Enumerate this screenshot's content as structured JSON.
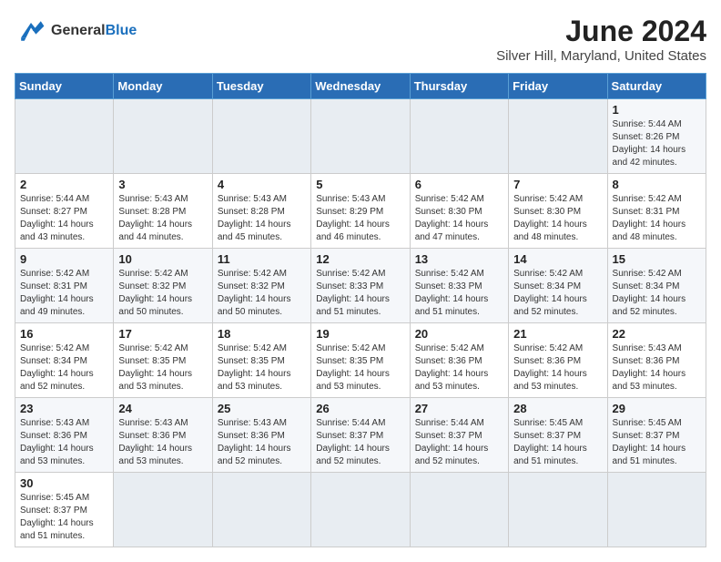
{
  "header": {
    "logo_general": "General",
    "logo_blue": "Blue",
    "title": "June 2024",
    "subtitle": "Silver Hill, Maryland, United States"
  },
  "weekdays": [
    "Sunday",
    "Monday",
    "Tuesday",
    "Wednesday",
    "Thursday",
    "Friday",
    "Saturday"
  ],
  "weeks": [
    [
      {
        "day": "",
        "info": ""
      },
      {
        "day": "",
        "info": ""
      },
      {
        "day": "",
        "info": ""
      },
      {
        "day": "",
        "info": ""
      },
      {
        "day": "",
        "info": ""
      },
      {
        "day": "",
        "info": ""
      },
      {
        "day": "1",
        "info": "Sunrise: 5:44 AM\nSunset: 8:26 PM\nDaylight: 14 hours and 42 minutes."
      }
    ],
    [
      {
        "day": "2",
        "info": "Sunrise: 5:44 AM\nSunset: 8:27 PM\nDaylight: 14 hours and 43 minutes."
      },
      {
        "day": "3",
        "info": "Sunrise: 5:43 AM\nSunset: 8:28 PM\nDaylight: 14 hours and 44 minutes."
      },
      {
        "day": "4",
        "info": "Sunrise: 5:43 AM\nSunset: 8:28 PM\nDaylight: 14 hours and 45 minutes."
      },
      {
        "day": "5",
        "info": "Sunrise: 5:43 AM\nSunset: 8:29 PM\nDaylight: 14 hours and 46 minutes."
      },
      {
        "day": "6",
        "info": "Sunrise: 5:42 AM\nSunset: 8:30 PM\nDaylight: 14 hours and 47 minutes."
      },
      {
        "day": "7",
        "info": "Sunrise: 5:42 AM\nSunset: 8:30 PM\nDaylight: 14 hours and 48 minutes."
      },
      {
        "day": "8",
        "info": "Sunrise: 5:42 AM\nSunset: 8:31 PM\nDaylight: 14 hours and 48 minutes."
      }
    ],
    [
      {
        "day": "9",
        "info": "Sunrise: 5:42 AM\nSunset: 8:31 PM\nDaylight: 14 hours and 49 minutes."
      },
      {
        "day": "10",
        "info": "Sunrise: 5:42 AM\nSunset: 8:32 PM\nDaylight: 14 hours and 50 minutes."
      },
      {
        "day": "11",
        "info": "Sunrise: 5:42 AM\nSunset: 8:32 PM\nDaylight: 14 hours and 50 minutes."
      },
      {
        "day": "12",
        "info": "Sunrise: 5:42 AM\nSunset: 8:33 PM\nDaylight: 14 hours and 51 minutes."
      },
      {
        "day": "13",
        "info": "Sunrise: 5:42 AM\nSunset: 8:33 PM\nDaylight: 14 hours and 51 minutes."
      },
      {
        "day": "14",
        "info": "Sunrise: 5:42 AM\nSunset: 8:34 PM\nDaylight: 14 hours and 52 minutes."
      },
      {
        "day": "15",
        "info": "Sunrise: 5:42 AM\nSunset: 8:34 PM\nDaylight: 14 hours and 52 minutes."
      }
    ],
    [
      {
        "day": "16",
        "info": "Sunrise: 5:42 AM\nSunset: 8:34 PM\nDaylight: 14 hours and 52 minutes."
      },
      {
        "day": "17",
        "info": "Sunrise: 5:42 AM\nSunset: 8:35 PM\nDaylight: 14 hours and 53 minutes."
      },
      {
        "day": "18",
        "info": "Sunrise: 5:42 AM\nSunset: 8:35 PM\nDaylight: 14 hours and 53 minutes."
      },
      {
        "day": "19",
        "info": "Sunrise: 5:42 AM\nSunset: 8:35 PM\nDaylight: 14 hours and 53 minutes."
      },
      {
        "day": "20",
        "info": "Sunrise: 5:42 AM\nSunset: 8:36 PM\nDaylight: 14 hours and 53 minutes."
      },
      {
        "day": "21",
        "info": "Sunrise: 5:42 AM\nSunset: 8:36 PM\nDaylight: 14 hours and 53 minutes."
      },
      {
        "day": "22",
        "info": "Sunrise: 5:43 AM\nSunset: 8:36 PM\nDaylight: 14 hours and 53 minutes."
      }
    ],
    [
      {
        "day": "23",
        "info": "Sunrise: 5:43 AM\nSunset: 8:36 PM\nDaylight: 14 hours and 53 minutes."
      },
      {
        "day": "24",
        "info": "Sunrise: 5:43 AM\nSunset: 8:36 PM\nDaylight: 14 hours and 53 minutes."
      },
      {
        "day": "25",
        "info": "Sunrise: 5:43 AM\nSunset: 8:36 PM\nDaylight: 14 hours and 52 minutes."
      },
      {
        "day": "26",
        "info": "Sunrise: 5:44 AM\nSunset: 8:37 PM\nDaylight: 14 hours and 52 minutes."
      },
      {
        "day": "27",
        "info": "Sunrise: 5:44 AM\nSunset: 8:37 PM\nDaylight: 14 hours and 52 minutes."
      },
      {
        "day": "28",
        "info": "Sunrise: 5:45 AM\nSunset: 8:37 PM\nDaylight: 14 hours and 51 minutes."
      },
      {
        "day": "29",
        "info": "Sunrise: 5:45 AM\nSunset: 8:37 PM\nDaylight: 14 hours and 51 minutes."
      }
    ],
    [
      {
        "day": "30",
        "info": "Sunrise: 5:45 AM\nSunset: 8:37 PM\nDaylight: 14 hours and 51 minutes."
      },
      {
        "day": "",
        "info": ""
      },
      {
        "day": "",
        "info": ""
      },
      {
        "day": "",
        "info": ""
      },
      {
        "day": "",
        "info": ""
      },
      {
        "day": "",
        "info": ""
      },
      {
        "day": "",
        "info": ""
      }
    ]
  ]
}
